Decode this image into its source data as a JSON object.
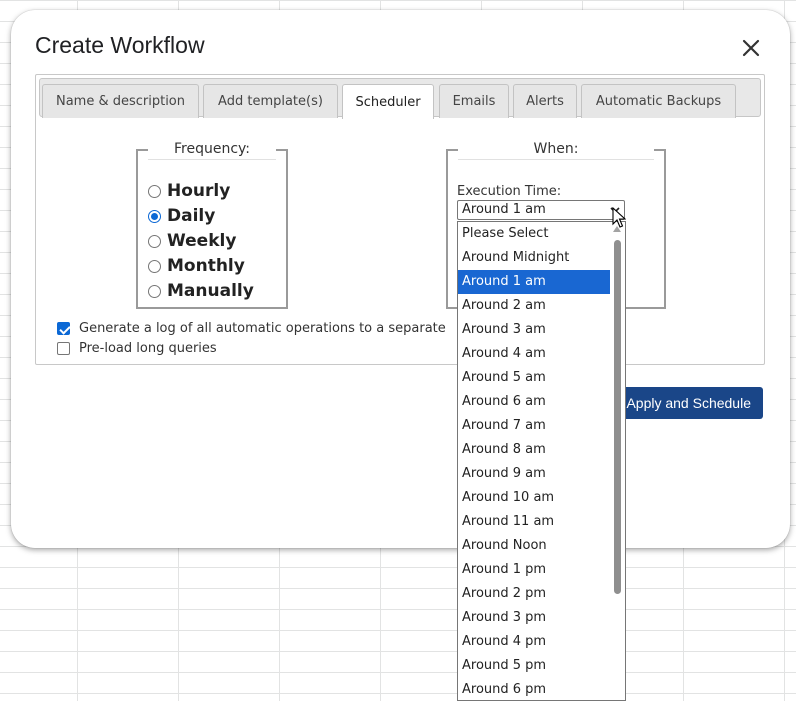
{
  "dialog": {
    "title": "Create Workflow"
  },
  "tabs": [
    {
      "label": "Name & description",
      "active": false
    },
    {
      "label": "Add template(s)",
      "active": false
    },
    {
      "label": "Scheduler",
      "active": true
    },
    {
      "label": "Emails",
      "active": false
    },
    {
      "label": "Alerts",
      "active": false
    },
    {
      "label": "Automatic Backups",
      "active": false
    }
  ],
  "frequency": {
    "legend": "Frequency:",
    "options": [
      {
        "label": "Hourly",
        "checked": false
      },
      {
        "label": "Daily",
        "checked": true
      },
      {
        "label": "Weekly",
        "checked": false
      },
      {
        "label": "Monthly",
        "checked": false
      },
      {
        "label": "Manually",
        "checked": false
      }
    ]
  },
  "when": {
    "legend": "When:",
    "execution_label": "Execution Time:",
    "selected": "Around 1 am",
    "options": [
      "Please Select",
      "Around Midnight",
      "Around 1 am",
      "Around 2 am",
      "Around 3 am",
      "Around 4 am",
      "Around 5 am",
      "Around 6 am",
      "Around 7 am",
      "Around 8 am",
      "Around 9 am",
      "Around 10 am",
      "Around 11 am",
      "Around Noon",
      "Around 1 pm",
      "Around 2 pm",
      "Around 3 pm",
      "Around 4 pm",
      "Around 5 pm",
      "Around 6 pm"
    ]
  },
  "checkboxes": [
    {
      "label": "Generate a log of all automatic operations to a separate",
      "checked": true
    },
    {
      "label": "Pre-load long queries",
      "checked": false
    }
  ],
  "apply_button": {
    "label": "Apply and Schedule"
  },
  "colors": {
    "accent": "#1967d2",
    "apply_button": "#1a4688"
  }
}
